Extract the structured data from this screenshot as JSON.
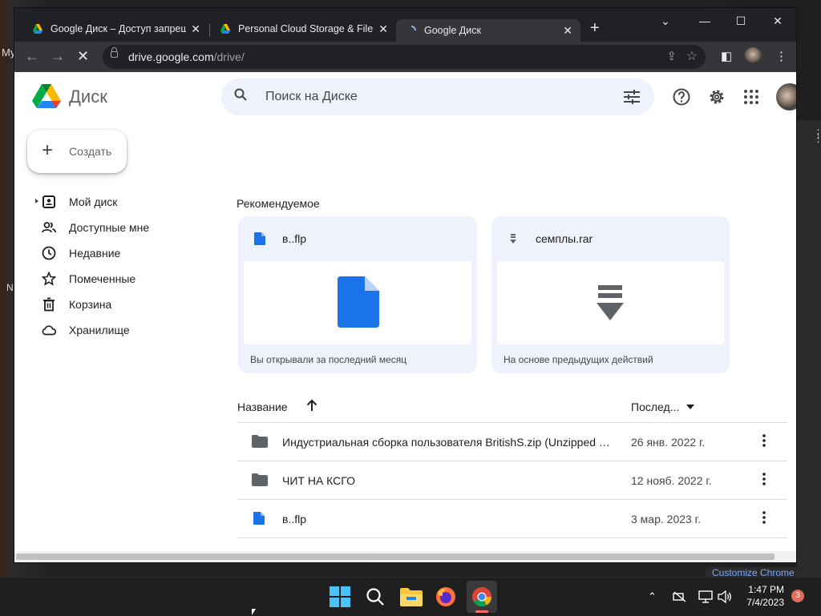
{
  "desktop": {
    "left_text": "My",
    "left_letter": "N",
    "customize": "Customize Chrome"
  },
  "browser": {
    "tabs": [
      {
        "title": "Google Диск – Доступ запрещен",
        "active": false
      },
      {
        "title": "Personal Cloud Storage & File S",
        "active": false
      },
      {
        "title": "Google Диск",
        "active": true
      }
    ],
    "url_host": "drive.google.com",
    "url_path": "/drive/"
  },
  "drive": {
    "brand": "Диск",
    "search_placeholder": "Поиск на Диске",
    "create_label": "Создать",
    "nav": [
      {
        "label": "Мой диск",
        "icon": "my-drive-icon"
      },
      {
        "label": "Доступные мне",
        "icon": "shared-icon"
      },
      {
        "label": "Недавние",
        "icon": "clock-icon"
      },
      {
        "label": "Помеченные",
        "icon": "star-icon"
      },
      {
        "label": "Корзина",
        "icon": "trash-icon"
      },
      {
        "label": "Хранилище",
        "icon": "cloud-icon"
      }
    ],
    "recommended_title": "Рекомендуемое",
    "suggested": [
      {
        "name": "в..flp",
        "reason": "Вы открывали за последний месяц",
        "icon": "file-icon"
      },
      {
        "name": "семплы.rar",
        "reason": "На основе предыдущих действий",
        "icon": "archive-icon"
      }
    ],
    "list_header": {
      "name": "Название",
      "modified": "Послед..."
    },
    "files": [
      {
        "name": "Индустриальная сборка пользователя BritishS.zip (Unzipped Files)",
        "date": "26 янв. 2022 г.",
        "icon": "folder-icon"
      },
      {
        "name": "ЧИТ НА КСГО",
        "date": "12 нояб. 2022 г.",
        "icon": "folder-icon"
      },
      {
        "name": "в..flp",
        "date": "3 мар. 2023 г.",
        "icon": "file-icon"
      }
    ]
  },
  "taskbar": {
    "time": "1:47 PM",
    "date": "7/4/2023",
    "notifications": "3"
  },
  "colors": {
    "drive_blue": "#1a73e8",
    "search_bg": "#edf2fc",
    "chrome_dark": "#202124"
  }
}
